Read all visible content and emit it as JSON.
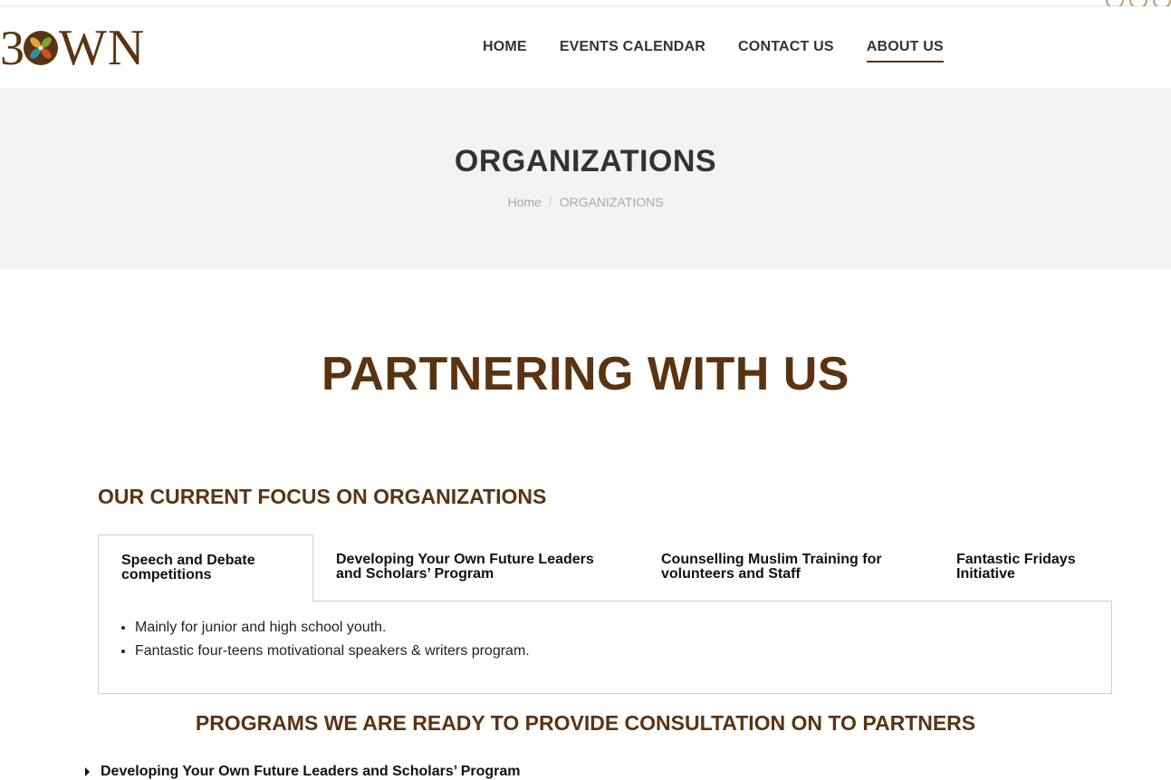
{
  "header": {
    "logo": {
      "sprout_glyph": "3",
      "text": "WN",
      "brand_color": "#5a3412"
    },
    "nav": [
      {
        "label": "HOME",
        "active": false
      },
      {
        "label": "EVENTS CALENDAR",
        "active": false
      },
      {
        "label": "CONTACT US",
        "active": false
      },
      {
        "label": "ABOUT US",
        "active": true
      }
    ]
  },
  "title_band": {
    "title": "ORGANIZATIONS",
    "breadcrumb": {
      "home": "Home",
      "separator": "/",
      "current": "ORGANIZATIONS"
    },
    "background": "#f3f3f3"
  },
  "main": {
    "heading": "PARTNERING WITH US",
    "focus_heading": "OUR CURRENT FOCUS ON ORGANIZATIONS",
    "tabs": [
      {
        "label": "Speech and Debate competitions",
        "active": true
      },
      {
        "label": "Developing Your Own Future Leaders and Scholars’ Program",
        "active": false
      },
      {
        "label": "Counselling Muslim Training for volunteers and Staff",
        "active": false
      },
      {
        "label": "Fantastic Fridays Initiative",
        "active": false
      }
    ],
    "active_panel": {
      "items": [
        "Mainly for junior and high school youth.",
        "Fantastic four-teens motivational speakers & writers program."
      ]
    },
    "programs_heading": "PROGRAMS WE ARE READY TO PROVIDE CONSULTATION ON TO PARTNERS",
    "accordion": [
      {
        "label": "Developing Your Own Future Leaders and Scholars’ Program",
        "icon": "caret-right-icon"
      }
    ]
  },
  "colors": {
    "accent": "#5a3412",
    "text": "#222222",
    "muted": "#a8a8a8",
    "border": "#cfcfcf"
  }
}
